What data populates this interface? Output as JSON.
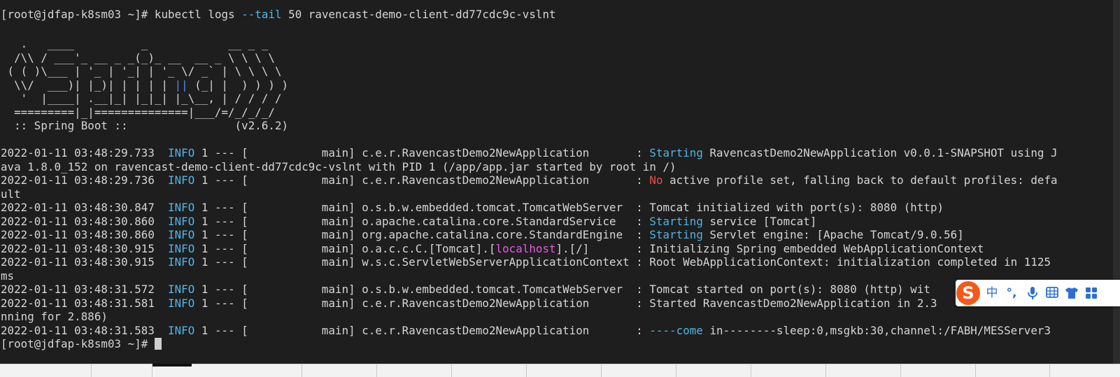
{
  "terminal": {
    "command_line": {
      "prompt": "[root@jdfap-k8sm03 ~]# ",
      "cmd_before": "kubectl logs ",
      "flag": "--tail",
      "cmd_after": " 50 ravencast-demo-client-dd77cdc9c-vslnt"
    },
    "banner": {
      "l1": "   .   ____          _            __ _ _",
      "l2a": "  /\\\\ / ___'_ __ _ _(_)_ __  __ _ \\ \\ \\ \\",
      "l3": " ( ( )\\___ | '_ | '_| | '_ \\/ _` | \\ \\ \\ \\",
      "l4a": "  \\\\/  ___)| |_)| | | | | ",
      "l4b": "||",
      "l4c": " (_| |  ) ) ) )",
      "l5": "   '  |____| .__|_| |_|_| |_\\__, | / / / /",
      "l6": "  =========|_|==============|___/=/_/_/_/",
      "l7": "  :: Spring Boot ::                (v2.6.2)"
    },
    "logs": {
      "l1": {
        "ts": "2022-01-11 03:48:29.733",
        "level": "INFO",
        "mid": " 1 --- [           main] c.e.r.RavencastDemo2NewApplication       : ",
        "hl": "Starting",
        "rest": " RavencastDemo2NewApplication v0.0.1-SNAPSHOT using J"
      },
      "l1_cont": "ava 1.8.0_152 on ravencast-demo-client-dd77cdc9c-vslnt with PID 1 (/app/app.jar started by root in /)",
      "l2": {
        "ts": "2022-01-11 03:48:29.736",
        "level": "INFO",
        "mid": " 1 --- [           main] c.e.r.RavencastDemo2NewApplication       : ",
        "hl": "No",
        "rest": " active profile set, falling back to default profiles: defa"
      },
      "l2_cont": "ult",
      "l3": {
        "ts": "2022-01-11 03:48:30.847",
        "level": "INFO",
        "mid": " 1 --- [           main] o.s.b.w.embedded.tomcat.TomcatWebServer  : ",
        "rest": "Tomcat initialized with port(s): 8080 (http)"
      },
      "l4": {
        "ts": "2022-01-11 03:48:30.860",
        "level": "INFO",
        "mid": " 1 --- [           main] o.apache.catalina.core.StandardService   : ",
        "hl": "Starting",
        "rest": " service [Tomcat]"
      },
      "l5": {
        "ts": "2022-01-11 03:48:30.860",
        "level": "INFO",
        "mid": " 1 --- [           main] org.apache.catalina.core.StandardEngine  : ",
        "hl": "Starting",
        "rest": " Servlet engine: [Apache Tomcat/9.0.56]"
      },
      "l6": {
        "ts": "2022-01-11 03:48:30.915",
        "level": "INFO",
        "mid": " 1 --- [           main] o.a.c.c.C.[Tomcat].[",
        "hl": "localhost",
        "rest": "].[/]       : Initializing Spring embedded WebApplicationContext"
      },
      "l7": {
        "ts": "2022-01-11 03:48:30.915",
        "level": "INFO",
        "mid": " 1 --- [           main] w.s.c.ServletWebServerApplicationContext : ",
        "rest": "Root WebApplicationContext: initialization completed in 1125"
      },
      "l7_cont": "ms",
      "l8": {
        "ts": "2022-01-11 03:48:31.572",
        "level": "INFO",
        "mid": " 1 --- [           main] o.s.b.w.embedded.tomcat.TomcatWebServer  : ",
        "rest": "Tomcat started on port(s): 8080 (http) wit"
      },
      "l9": {
        "ts": "2022-01-11 03:48:31.581",
        "level": "INFO",
        "mid": " 1 --- [           main] c.e.r.RavencastDemo2NewApplication       : ",
        "rest": "Started RavencastDemo2NewApplication in 2.3"
      },
      "l9_cont": "nning for 2.886)",
      "l10": {
        "ts": "2022-01-11 03:48:31.583",
        "level": "INFO",
        "mid": " 1 --- [           main] c.e.r.RavencastDemo2NewApplication       : ",
        "hl": "----come",
        "rest": " in--------sleep:0,msgkb:30,channel:/FABH/MESServer3"
      }
    },
    "final_prompt": "[root@jdfap-k8sm03 ~]# "
  },
  "ime": {
    "logo": "S",
    "lang": "中",
    "punct": "°,",
    "icons": [
      "microphone-icon",
      "keyboard-icon",
      "shirt-icon",
      "more-icon"
    ]
  },
  "colors": {
    "background": "#1e1e1e",
    "text": "#d6d6d6",
    "info": "#4fb6e6",
    "warn_red": "#f44b4b",
    "magenta": "#e45be4",
    "ime_orange": "#f35a1a",
    "ime_blue": "#2b6fd6"
  }
}
